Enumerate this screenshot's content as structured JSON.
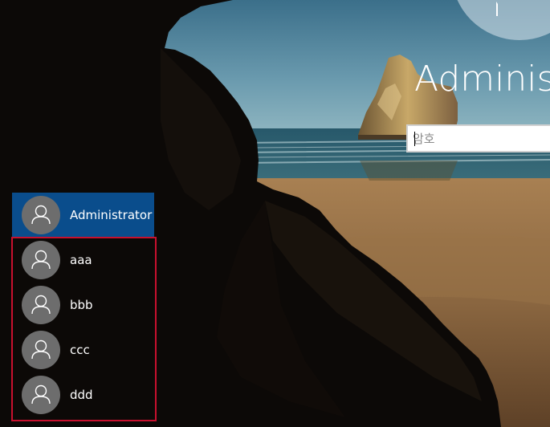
{
  "login": {
    "selected_user": "Administrator",
    "password_placeholder": "암호"
  },
  "user_list": [
    {
      "name": "Administrator",
      "selected": true,
      "icon": "user-icon"
    },
    {
      "name": "aaa",
      "selected": false,
      "icon": "user-icon"
    },
    {
      "name": "bbb",
      "selected": false,
      "icon": "user-icon"
    },
    {
      "name": "ccc",
      "selected": false,
      "icon": "user-icon"
    },
    {
      "name": "ddd",
      "selected": false,
      "icon": "user-icon"
    }
  ],
  "colors": {
    "selected_item": "#0a4d8c",
    "annotation_border": "#c8102e",
    "avatar_bg": "#6d6d6d"
  }
}
